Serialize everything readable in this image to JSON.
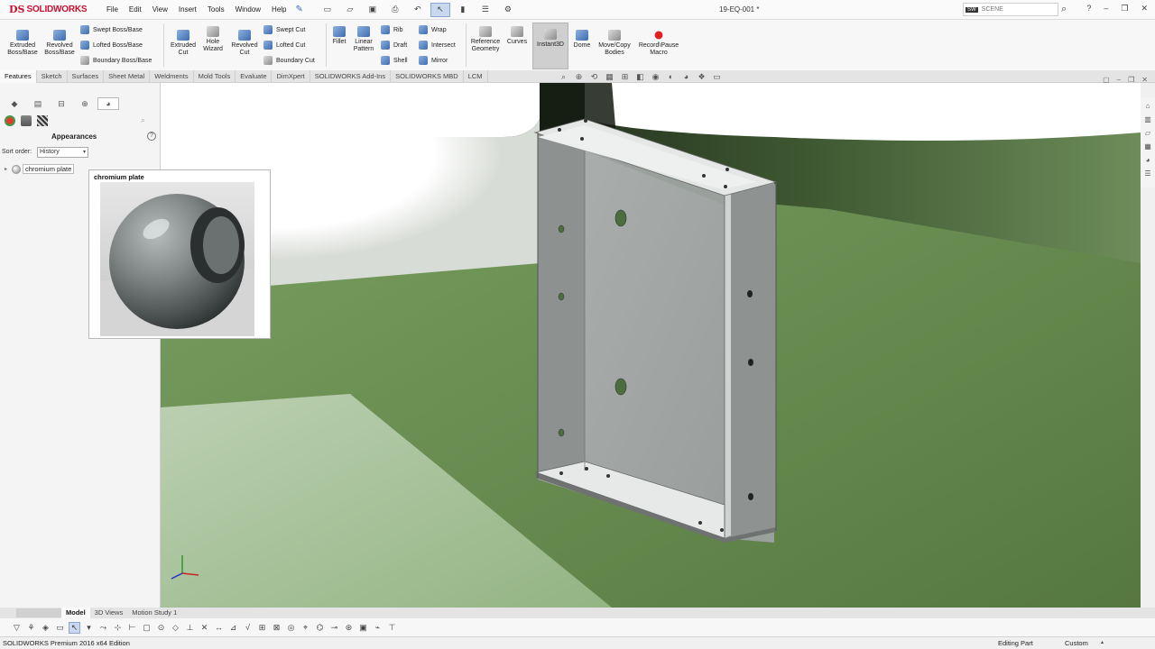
{
  "app": {
    "logo_ds": "DS",
    "logo_name": "SOLIDWORKS"
  },
  "menu": [
    "File",
    "Edit",
    "View",
    "Insert",
    "Tools",
    "Window",
    "Help"
  ],
  "document": {
    "title": "19-EQ-001 *"
  },
  "search": {
    "scope_label": "SCENE"
  },
  "ribbon": {
    "extruded_boss": "Extruded\nBoss/Base",
    "revolved_boss": "Revolved\nBoss/Base",
    "swept_boss": "Swept Boss/Base",
    "lofted_boss": "Lofted Boss/Base",
    "boundary_boss": "Boundary Boss/Base",
    "extruded_cut": "Extruded\nCut",
    "hole_wizard": "Hole\nWizard",
    "revolved_cut": "Revolved\nCut",
    "swept_cut": "Swept Cut",
    "lofted_cut": "Lofted Cut",
    "boundary_cut": "Boundary Cut",
    "fillet": "Fillet",
    "linear_pattern": "Linear\nPattern",
    "rib": "Rib",
    "draft": "Draft",
    "shell": "Shell",
    "wrap": "Wrap",
    "intersect": "Intersect",
    "mirror": "Mirror",
    "reference_geometry": "Reference\nGeometry",
    "curves": "Curves",
    "instant3d": "Instant3D",
    "dome": "Dome",
    "move_copy": "Move/Copy\nBodies",
    "record_macro": "Record\\Pause\nMacro"
  },
  "tabs": [
    "Features",
    "Sketch",
    "Surfaces",
    "Sheet Metal",
    "Weldments",
    "Mold Tools",
    "Evaluate",
    "DimXpert",
    "SOLIDWORKS Add-Ins",
    "SOLIDWORKS MBD",
    "LCM"
  ],
  "panel": {
    "heading": "Appearances",
    "sort_label": "Sort order:",
    "sort_value": "History",
    "tree_item": "chromium plate",
    "tooltip_title": "chromium plate"
  },
  "bottom_tabs": [
    "Model",
    "3D Views",
    "Motion Study 1"
  ],
  "status": {
    "edition": "SOLIDWORKS Premium 2016 x64 Edition",
    "mode": "Editing Part",
    "units": "Custom"
  },
  "colors": {
    "brand_red": "#c8102e",
    "floor_green": "#5e8447",
    "part_gray": "#a6aaa8"
  },
  "icons": [
    "new-icon",
    "open-icon",
    "save-icon",
    "print-icon",
    "undo-icon",
    "select-icon",
    "rebuild-icon",
    "file-properties-icon",
    "options-icon",
    "search-icon",
    "help-icon"
  ]
}
